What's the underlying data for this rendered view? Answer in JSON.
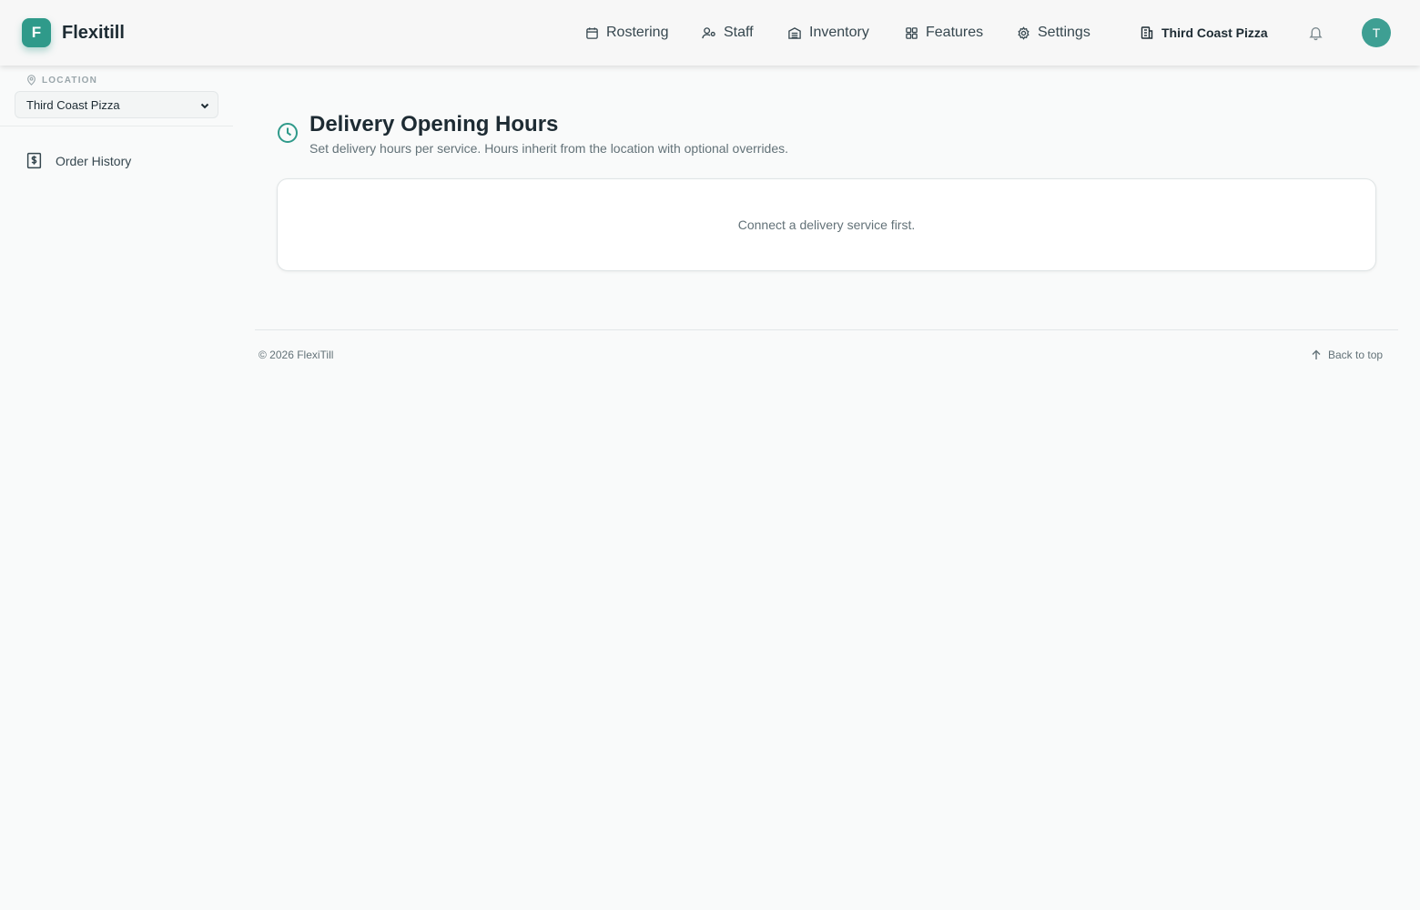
{
  "app": {
    "logo_letter": "F",
    "name": "Flexitill"
  },
  "nav": {
    "items": [
      {
        "label": "Rostering",
        "icon": "calendar-icon"
      },
      {
        "label": "Staff",
        "icon": "user-icon"
      },
      {
        "label": "Inventory",
        "icon": "warehouse-icon"
      },
      {
        "label": "Features",
        "icon": "grid-icon"
      },
      {
        "label": "Settings",
        "icon": "gear-icon"
      }
    ],
    "location_label": "Third Coast Pizza",
    "avatar_initial": "T"
  },
  "sidebar": {
    "location_heading": "LOCATION",
    "location_selected": "Third Coast Pizza",
    "items": [
      {
        "label": "Order History",
        "icon": "receipt-dollar-icon"
      }
    ]
  },
  "main": {
    "title": "Delivery Opening Hours",
    "subtitle": "Set delivery hours per service. Hours inherit from the location with optional overrides.",
    "empty_message": "Connect a delivery service first."
  },
  "footer": {
    "copyright": "© 2026 FlexiTill",
    "back_to_top": "Back to top"
  },
  "colors": {
    "accent": "#2f9a8a",
    "background": "#f9fafa",
    "text": "#1d2b33",
    "muted": "#637278"
  }
}
